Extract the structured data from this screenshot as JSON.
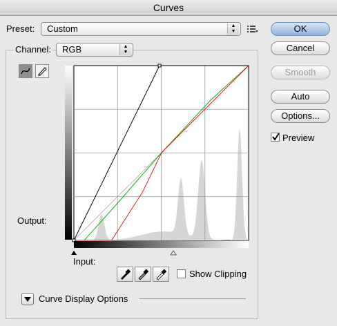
{
  "window": {
    "title": "Curves"
  },
  "preset": {
    "label": "Preset:",
    "value": "Custom"
  },
  "channel": {
    "label": "Channel:",
    "value": "RGB"
  },
  "buttons": {
    "ok": "OK",
    "cancel": "Cancel",
    "smooth": "Smooth",
    "auto": "Auto",
    "options": "Options..."
  },
  "preview": {
    "label": "Preview",
    "checked": true
  },
  "labels": {
    "output": "Output:",
    "input": "Input:"
  },
  "show_clipping": {
    "label": "Show Clipping",
    "checked": false
  },
  "display_options": {
    "label": "Curve Display Options"
  },
  "curves": {
    "range": [
      0,
      255
    ],
    "colors": {
      "rgb": "#000000",
      "red": "#e02020",
      "green": "#10b010",
      "baseline": "#b0b0b0",
      "histogram": "#d6d6d6"
    },
    "rgb_points": [
      [
        0,
        0
      ],
      [
        125,
        255
      ],
      [
        255,
        255
      ]
    ],
    "red_points": [
      [
        0,
        0
      ],
      [
        55,
        0
      ],
      [
        100,
        70
      ],
      [
        128,
        128
      ],
      [
        190,
        190
      ],
      [
        255,
        255
      ]
    ],
    "green_points": [
      [
        0,
        0
      ],
      [
        15,
        0
      ],
      [
        60,
        50
      ],
      [
        128,
        128
      ],
      [
        200,
        205
      ],
      [
        255,
        255
      ]
    ]
  }
}
